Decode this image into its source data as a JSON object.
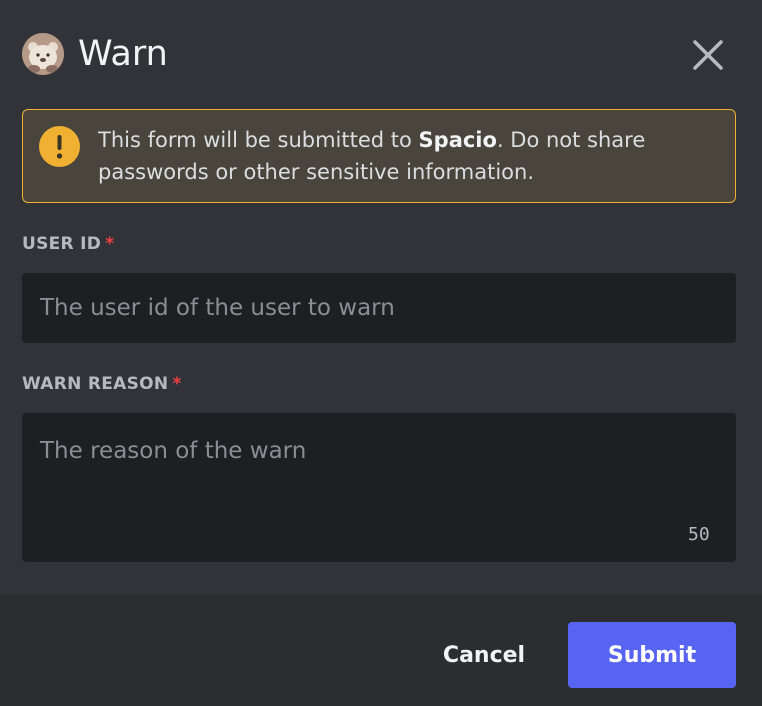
{
  "modal": {
    "title": "Warn",
    "close_icon": "close-icon",
    "avatar_icon": "bear-avatar-icon"
  },
  "notice": {
    "icon": "warning-icon",
    "text_prefix": "This form will be submitted to ",
    "app_name": "Spacio",
    "text_suffix": ". Do not share passwords or other sensitive information.",
    "border_color": "#f0b132",
    "background_color": "#49443c"
  },
  "fields": {
    "user_id": {
      "label": "USER ID",
      "required_mark": "*",
      "placeholder": "The user id of the user to warn",
      "value": ""
    },
    "warn_reason": {
      "label": "WARN REASON",
      "required_mark": "*",
      "placeholder": "The reason of the warn",
      "value": "",
      "counter": "50"
    }
  },
  "footer": {
    "cancel_label": "Cancel",
    "submit_label": "Submit",
    "submit_color": "#5865f2"
  }
}
